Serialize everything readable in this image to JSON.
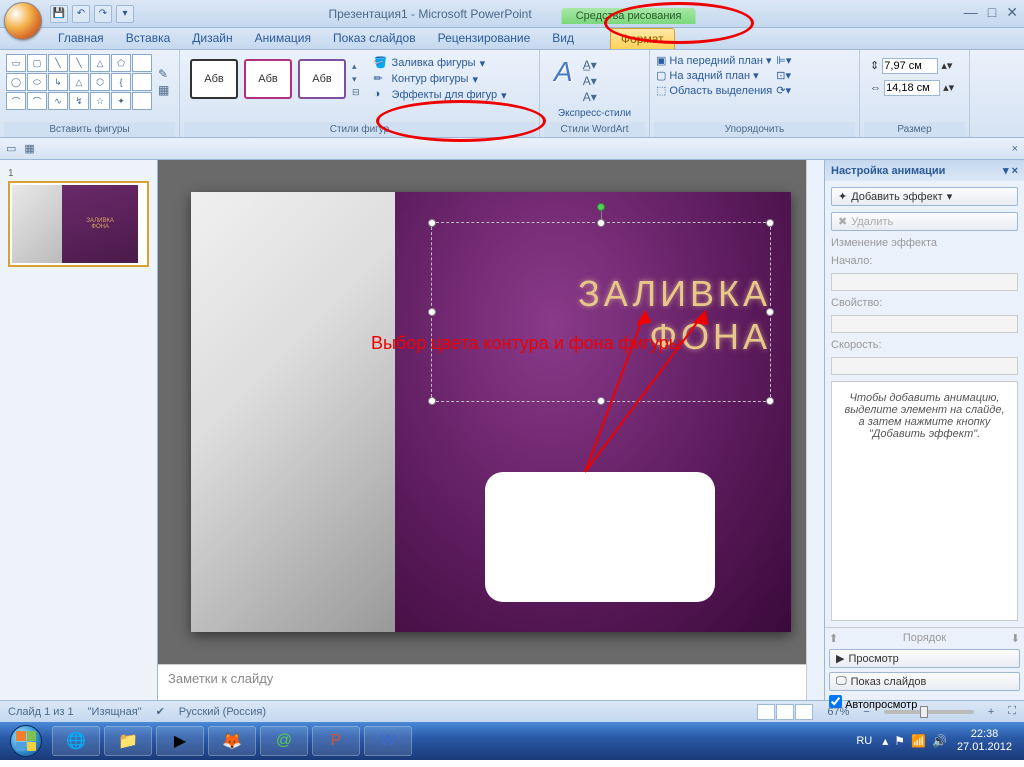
{
  "title": "Презентация1 - Microsoft PowerPoint",
  "tools_context": "Средства рисования",
  "tabs": {
    "home": "Главная",
    "insert": "Вставка",
    "design": "Дизайн",
    "animation": "Анимация",
    "slideshow": "Показ слайдов",
    "review": "Рецензирование",
    "view": "Вид",
    "format": "Формат"
  },
  "ribbon": {
    "insert_shapes": "Вставить фигуры",
    "shape_styles": "Стили фигур",
    "abv": "Абв",
    "shape_fill": "Заливка фигуры",
    "shape_outline": "Контур фигуры",
    "shape_effects": "Эффекты для фигур",
    "wordart_styles": "Стили WordArt",
    "express_styles": "Экспресс-стили",
    "arrange": "Упорядочить",
    "bring_front": "На передний план",
    "send_back": "На задний план",
    "selection_pane": "Область выделения",
    "size": "Размер",
    "height": "7,97 см",
    "width": "14,18 см"
  },
  "annotation": "Выбор цвета контура и фона фигуры",
  "slide_title_1": "ЗАЛИВКА",
  "slide_title_2": "ФОНА",
  "thumb_mini_1": "ЗАЛИВКА",
  "thumb_mini_2": "ФОНА",
  "notes_placeholder": "Заметки к слайду",
  "anim": {
    "title": "Настройка анимации",
    "add_effect": "Добавить эффект",
    "remove": "Удалить",
    "change_effect": "Изменение эффекта",
    "start": "Начало:",
    "property": "Свойство:",
    "speed": "Скорость:",
    "hint": "Чтобы добавить анимацию, выделите элемент на слайде, а затем нажмите кнопку \"Добавить эффект\".",
    "order": "Порядок",
    "preview": "Просмотр",
    "slideshow": "Показ слайдов",
    "autopreview": "Автопросмотр"
  },
  "status": {
    "slide": "Слайд 1 из 1",
    "theme": "\"Изящная\"",
    "lang": "Русский (Россия)",
    "zoom": "67%"
  },
  "tray": {
    "lang": "RU",
    "time": "22:38",
    "date": "27.01.2012"
  }
}
